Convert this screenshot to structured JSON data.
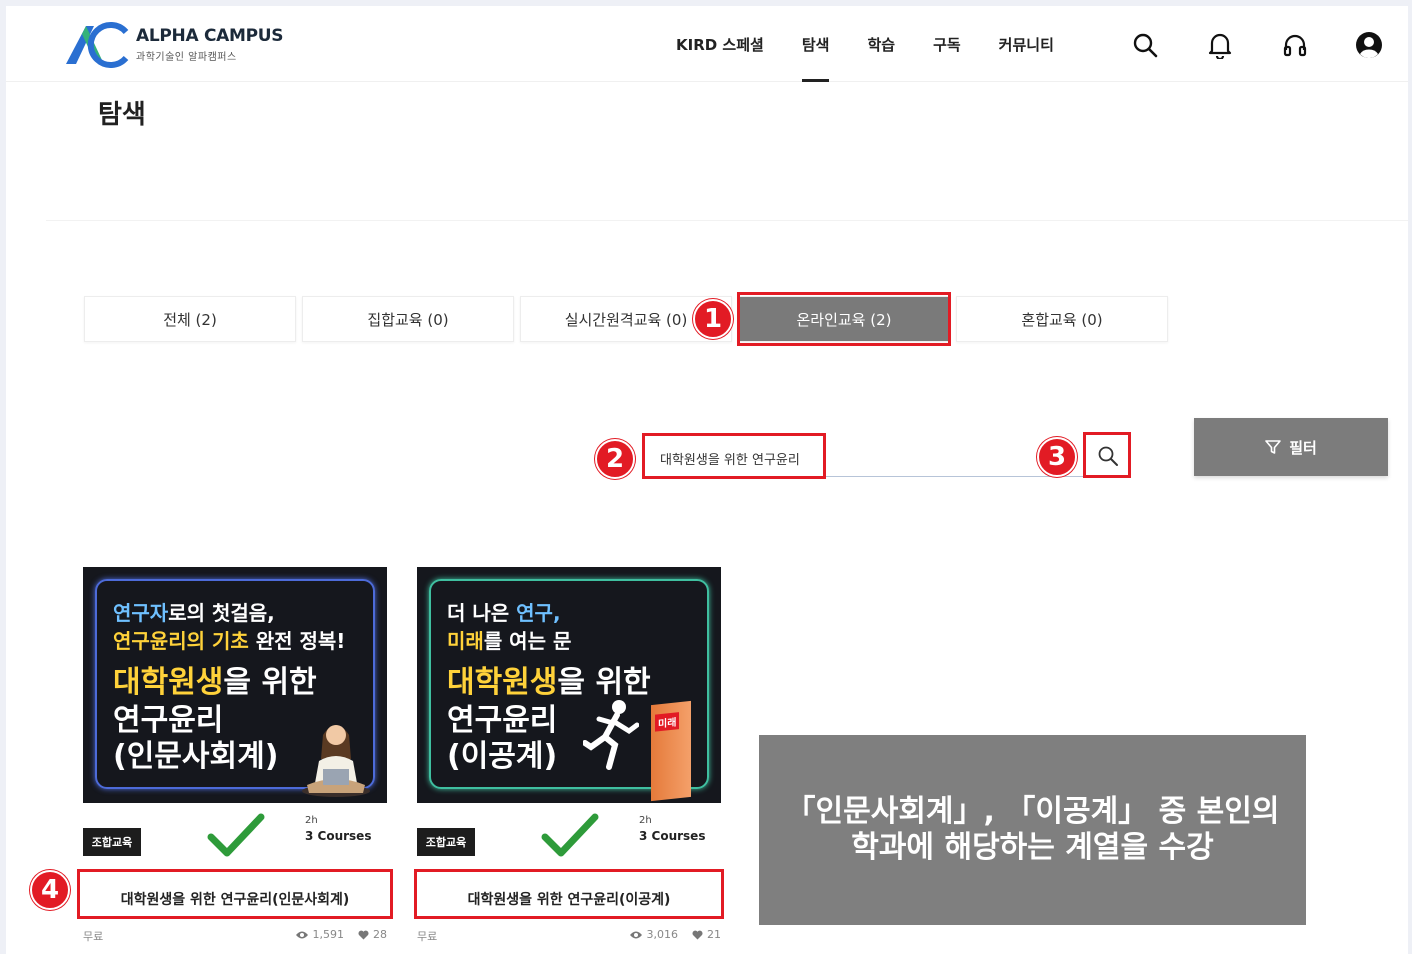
{
  "brand": {
    "name": "ALPHA CAMPUS",
    "subtitle": "과학기술인 알파캠퍼스",
    "colors": {
      "blue": "#2a6fd1",
      "green": "#34b27a"
    }
  },
  "nav": {
    "items": [
      {
        "label": "KIRD 스페셜"
      },
      {
        "label": "탐색",
        "active": true
      },
      {
        "label": "학습"
      },
      {
        "label": "구독"
      },
      {
        "label": "커뮤니티"
      }
    ],
    "icons": [
      "search-icon",
      "bell-icon",
      "headset-icon",
      "user-circle-icon"
    ]
  },
  "page": {
    "title": "탐색"
  },
  "tabs": [
    {
      "label": "전체 (2)"
    },
    {
      "label": "집합교육 (0)"
    },
    {
      "label": "실시간원격교육 (0)"
    },
    {
      "label": "온라인교육 (2)",
      "active": true
    },
    {
      "label": "혼합교육 (0)"
    }
  ],
  "search": {
    "value": "대학원생을 위한 연구윤리",
    "placeholder": ""
  },
  "filter": {
    "label": "필터",
    "icon": "filter-icon"
  },
  "steps": [
    "1",
    "2",
    "3",
    "4"
  ],
  "cards": [
    {
      "thumb": {
        "line1a": "연구자",
        "line1b": "로의 첫걸음,",
        "line2a": "연구윤리의 기초",
        "line2b": " 완전 정복!",
        "line3a": "대학원생",
        "line3b": "을 위한",
        "line4": "연구윤리",
        "line5": "(인문사회계)"
      },
      "badge": "조합교육",
      "hours": "2h",
      "courses": "3 Courses",
      "title": "대학원생을 위한 연구윤리(인문사회계)",
      "price": "무료",
      "views": "1,591",
      "likes": "28"
    },
    {
      "thumb": {
        "line1a": "더 나은 ",
        "line1b": "연구,",
        "line2a": "미래",
        "line2b": "를 여는 문",
        "line3a": "대학원생",
        "line3b": "을 위한",
        "line4": "연구윤리",
        "line5": "(이공계)",
        "door": "미래"
      },
      "badge": "조합교육",
      "hours": "2h",
      "courses": "3 Courses",
      "title": "대학원생을 위한 연구윤리(이공계)",
      "price": "무료",
      "views": "3,016",
      "likes": "21"
    }
  ],
  "note": {
    "line1": "「인문사회계」, 「이공계」 중 본인의",
    "line2": "학과에 해당하는 계열을 수강"
  },
  "colors": {
    "highlight": "#e21b24",
    "activeTab": "#7a7a7a",
    "note": "#7f7f7f"
  }
}
